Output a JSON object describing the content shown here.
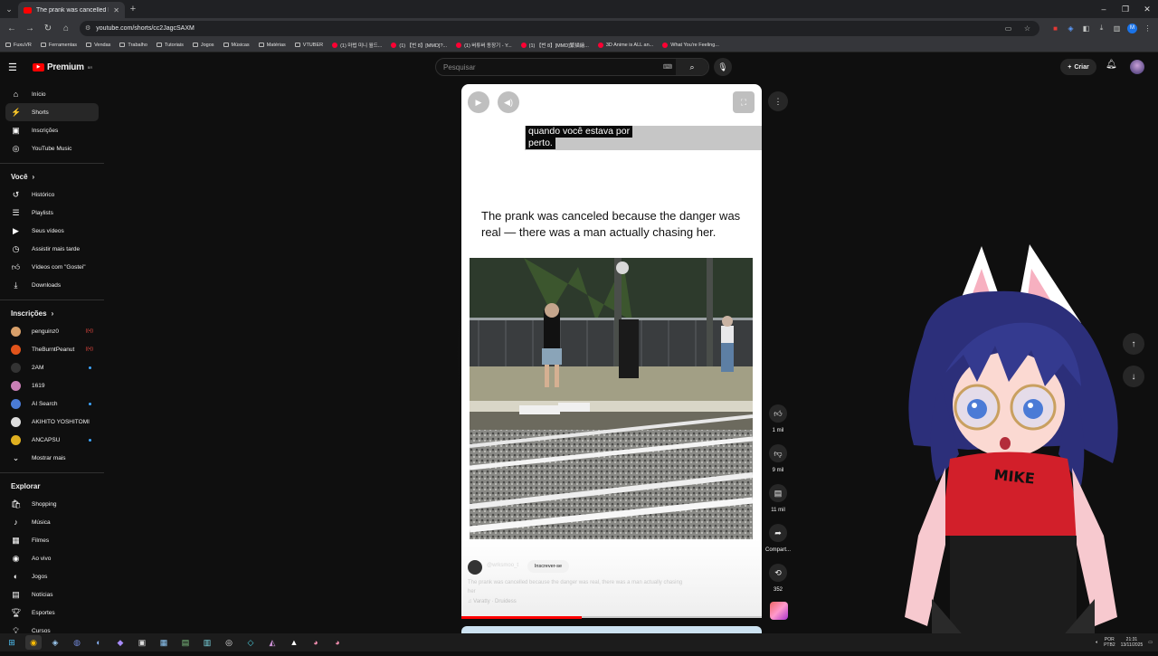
{
  "browser": {
    "tab_title": "The prank was cancelled becau...",
    "url": "youtube.com/shorts/cc2JagcSAXM",
    "profile_initial": "M",
    "bookmarks": [
      "FuxuVR",
      "Ferramentas",
      "Vendas",
      "Trabalho",
      "Tutoriais",
      "Jogos",
      "Músicas",
      "Matérias",
      "VTUBER",
      "(1) 마법 미니 월드...",
      "(1) 【번 8】[MMD]?...",
      "(1) 버튜버 동장기 - Y...",
      "(1) 【번 8】[MMD]繁描繪...",
      "3D Anime is ALL an...",
      "What You're Feeling..."
    ]
  },
  "header": {
    "logo_text": "Premium",
    "logo_region": "BR",
    "search_placeholder": "Pesquisar",
    "create_label": "Criar"
  },
  "sidebar": {
    "main": [
      {
        "label": "Início",
        "icon": "home-icon"
      },
      {
        "label": "Shorts",
        "icon": "shorts-icon",
        "active": true
      },
      {
        "label": "Inscrições",
        "icon": "subscriptions-icon"
      },
      {
        "label": "YouTube Music",
        "icon": "music-icon"
      }
    ],
    "you_title": "Você",
    "you": [
      {
        "label": "Histórico"
      },
      {
        "label": "Playlists"
      },
      {
        "label": "Seus vídeos"
      },
      {
        "label": "Assistir mais tarde"
      },
      {
        "label": "Vídeos com \"Gostei\""
      },
      {
        "label": "Downloads"
      }
    ],
    "subs_title": "Inscrições",
    "subs": [
      {
        "label": "penguinz0",
        "color": "#d9a06a",
        "badge": "live"
      },
      {
        "label": "TheBurntPeanut",
        "color": "#e2541b",
        "badge": "live"
      },
      {
        "label": "2AM",
        "color": "#333333",
        "badge": "dot"
      },
      {
        "label": "1619",
        "color": "#c97fb5",
        "badge": ""
      },
      {
        "label": "AI Search",
        "color": "#4a7bd6",
        "badge": "dot"
      },
      {
        "label": "AKIHITO YOSHITOMI",
        "color": "#dddddd",
        "badge": ""
      },
      {
        "label": "ANCAPSU",
        "color": "#e0b020",
        "badge": "dot"
      }
    ],
    "show_more": "Mostrar mais",
    "explore_title": "Explorar",
    "explore": [
      {
        "label": "Shopping"
      },
      {
        "label": "Música"
      },
      {
        "label": "Filmes"
      },
      {
        "label": "Ao vivo"
      },
      {
        "label": "Jogos"
      },
      {
        "label": "Notícias"
      },
      {
        "label": "Esportes"
      },
      {
        "label": "Cursos"
      }
    ]
  },
  "short": {
    "caption_line1": "quando você estava por",
    "caption_line2": "perto.",
    "headline": "The prank was canceled because the danger was real — there was a man actually chasing her.",
    "channel": "@wrksmoo_t",
    "subscribe": "Inscrever-se",
    "description": "The prank was cancelled because the danger was real, there was a man actually chasing her",
    "music": "♫  Varatty · Druidess",
    "progress": 0.4
  },
  "actions": {
    "likes": "1 mil",
    "dislikes": "9 mil",
    "comments": "11 mil",
    "share": "Compart...",
    "remix": "352"
  },
  "taskbar": {
    "lang": "POR",
    "layout": "PTB2",
    "time": "21:31",
    "date": "13/11/2025"
  },
  "colors": {
    "yt_red": "#ff0000",
    "background": "#0f0f0f",
    "link_blue": "#3ea6ff"
  }
}
